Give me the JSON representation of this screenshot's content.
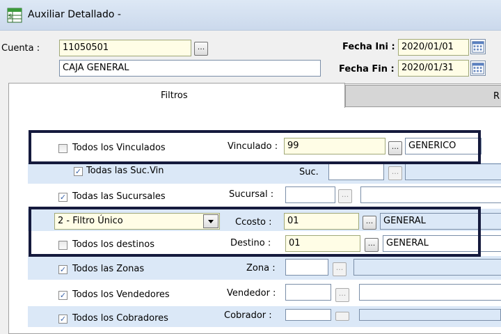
{
  "window": {
    "title": "Auxiliar Detallado -"
  },
  "header": {
    "cuenta_label": "Cuenta :",
    "cuenta_code": "11050501",
    "cuenta_name": "CAJA GENERAL",
    "fecha_ini_label": "Fecha Ini :",
    "fecha_ini": "2020/01/01",
    "fecha_fin_label": "Fecha Fin :",
    "fecha_fin": "2020/01/31",
    "lookup_label": "..."
  },
  "tabs": [
    {
      "label": "Filtros",
      "active": true
    },
    {
      "label": "R",
      "active": false
    }
  ],
  "filters": {
    "vinculados": {
      "checkbox": "Todos los Vinculados",
      "checked": false,
      "label": "Vinculado :",
      "code": "99",
      "name": "GENERICO"
    },
    "suc_vin": {
      "checkbox": "Todas las Suc.Vin",
      "checked": true,
      "label": "Suc.",
      "code": ""
    },
    "sucursales": {
      "checkbox": "Todas las Sucursales",
      "checked": true,
      "label": "Sucursal :",
      "code": ""
    },
    "ccosto": {
      "combo_value": "2 - Filtro Único",
      "label": "Ccosto :",
      "code": "01",
      "name": "GENERAL"
    },
    "destinos": {
      "checkbox": "Todos los destinos",
      "checked": false,
      "label": "Destino :",
      "code": "01",
      "name": "GENERAL"
    },
    "zonas": {
      "checkbox": "Todos las Zonas",
      "checked": true,
      "label": "Zona :",
      "code": ""
    },
    "vendedores": {
      "checkbox": "Todos los Vendedores",
      "checked": true,
      "label": "Vendedor :",
      "code": ""
    },
    "cobradores": {
      "checkbox": "Todos los Cobradores",
      "checked": true,
      "label": "Cobrador :",
      "code": ""
    }
  },
  "colors": {
    "highlight_border": "#151a3d",
    "row_blue": "#dbe8f7",
    "field_yellow": "#fffde6"
  }
}
